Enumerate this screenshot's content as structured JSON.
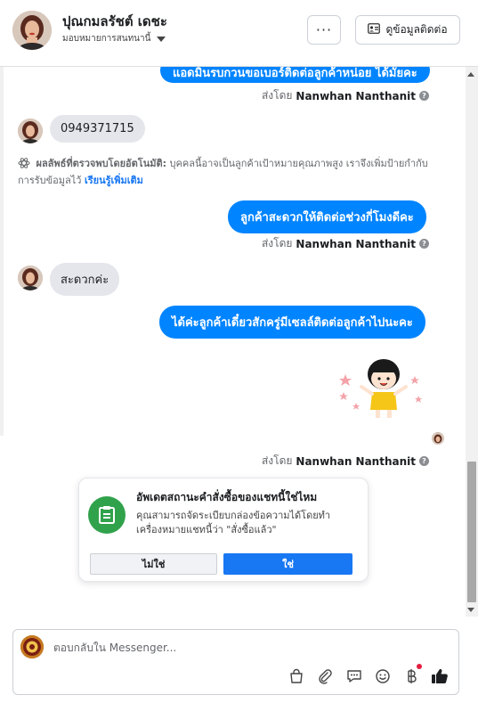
{
  "header": {
    "contact_name": "ปุณกมลรัชต์ เดชะ",
    "assign_label": "มอบหมายการสนทนานี้",
    "more_label": "···",
    "contact_button_label": "ดูข้อมูลติดต่อ"
  },
  "thread": {
    "top_message_partial": "แอดมินรบกวนขอเบอร์ติดต่อลูกค้าหน่อย ได้มั้ยคะ",
    "sent_by_prefix": "ส่งโดย",
    "sender_name": "Nanwhan Nanthanit",
    "incoming_phone": "0949371715",
    "auto_detect_title": "ผลลัพธ์ที่ตรวจพบโดยอัตโนมัติ:",
    "auto_detect_body": "บุคคลนี้อาจเป็นลูกค้าเป้าหมายคุณภาพสูง เราจึงเพิ่มป้ายกำกับการรับข้อมูลไว้",
    "auto_detect_link": "เรียนรู้เพิ่มเติม",
    "outgoing_2": "ลูกค้าสะดวกให้ติดต่อช่วงกี่โมงดีคะ",
    "incoming_2": "สะดวกค่ะ",
    "outgoing_3": "ได้ค่ะลูกค้าเดี๋ยวสักครู่มีเซลล์ติดต่อลูกค้าไปนะคะ"
  },
  "order_card": {
    "title": "อัพเดตสถานะคำสั่งซื้อของแชทนี้ใช่ไหม",
    "description": "คุณสามารถจัดระเบียบกล่องข้อความได้โดยทำเครื่องหมายแชทนี้ว่า \"สั่งซื้อแล้ว\"",
    "no_label": "ไม่ใช่",
    "yes_label": "ใช่"
  },
  "composer": {
    "placeholder": "ตอบกลับใน Messenger..."
  },
  "colors": {
    "messenger_blue": "#0084ff",
    "facebook_blue": "#1877f2",
    "order_green": "#31a24c"
  },
  "icons": [
    "more-icon",
    "contact-card-icon",
    "caret-down-icon",
    "sparkle-icon",
    "info-icon",
    "order-icon",
    "shopping-bag-icon",
    "paperclip-icon",
    "saved-reply-icon",
    "emoji-icon",
    "baht-icon",
    "thumbs-up-icon"
  ]
}
